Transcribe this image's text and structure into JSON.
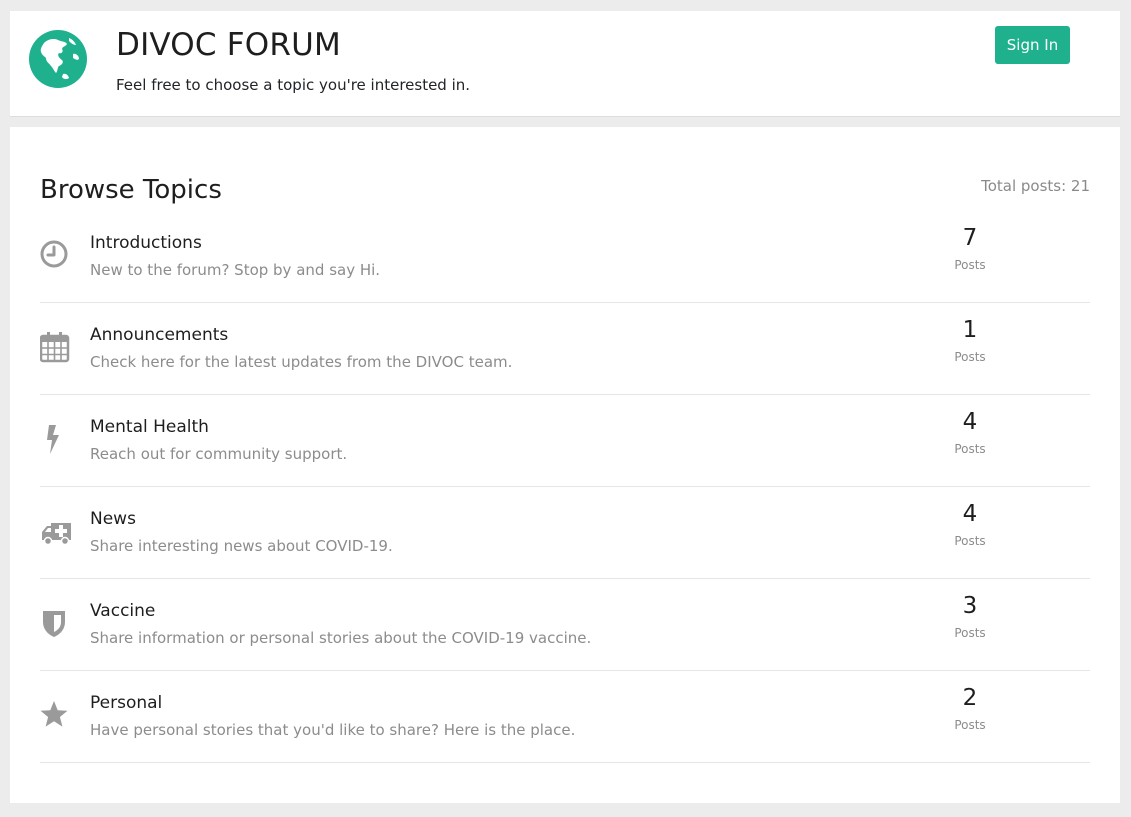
{
  "header": {
    "title": "DIVOC FORUM",
    "subtitle": "Feel free to choose a topic you're interested in.",
    "logo_icon": "globe-icon",
    "signin_label": "Sign In"
  },
  "colors": {
    "accent": "#1fb18e",
    "icon_gray": "#9a9a9a"
  },
  "main": {
    "title": "Browse Topics",
    "total_posts_label": "Total posts: 21",
    "topics": [
      {
        "name": "Introductions",
        "description": "New to the forum? Stop by and say Hi.",
        "count": "7",
        "count_label": "Posts",
        "icon": "clock-icon"
      },
      {
        "name": "Announcements",
        "description": "Check here for the latest updates from the DIVOC team.",
        "count": "1",
        "count_label": "Posts",
        "icon": "calendar-icon"
      },
      {
        "name": "Mental Health",
        "description": "Reach out for community support.",
        "count": "4",
        "count_label": "Posts",
        "icon": "bolt-icon"
      },
      {
        "name": "News",
        "description": "Share interesting news about COVID-19.",
        "count": "4",
        "count_label": "Posts",
        "icon": "ambulance-icon"
      },
      {
        "name": "Vaccine",
        "description": "Share information or personal stories about the COVID-19 vaccine.",
        "count": "3",
        "count_label": "Posts",
        "icon": "shield-icon"
      },
      {
        "name": "Personal",
        "description": "Have personal stories that you'd like to share? Here is the place.",
        "count": "2",
        "count_label": "Posts",
        "icon": "star-icon"
      }
    ]
  }
}
